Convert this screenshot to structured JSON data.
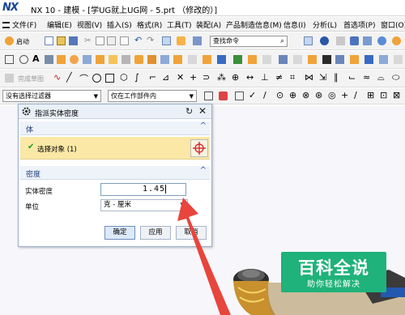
{
  "window": {
    "logo": "NX",
    "title": "NX 10 - 建模 - [学UG就上UG网 - 5.prt （修改的）]"
  },
  "menu": {
    "items": [
      "文件(F)",
      "编辑(E)",
      "视图(V)",
      "插入(S)",
      "格式(R)",
      "工具(T)",
      "装配(A)",
      "产品制造信息(M)",
      "信息(I)",
      "分析(L)",
      "首选项(P)",
      "窗口(O)"
    ]
  },
  "toolbar": {
    "start_label": "启动",
    "search_placeholder": "查找命令",
    "sketch_label": "完成草图"
  },
  "filters": {
    "selection_filter": "没有选择过滤器",
    "scope": "仅在工作部件内"
  },
  "dialog": {
    "title": "指派实体密度",
    "section_body": "体",
    "select_object_label": "选择对象 (1)",
    "section_density": "密度",
    "density_label": "实体密度",
    "density_value": "1.45",
    "unit_label": "单位",
    "unit_value": "克 - 厘米",
    "ok_label": "确定",
    "apply_label": "应用",
    "cancel_label": "取消"
  },
  "watermark": {
    "main": "百科全说",
    "sub": "助你轻松解决"
  },
  "colors": {
    "logo": "#15459a",
    "selected_row": "#fbe8a6",
    "arrow": "#e8453c",
    "watermark": "#1fb27a"
  }
}
